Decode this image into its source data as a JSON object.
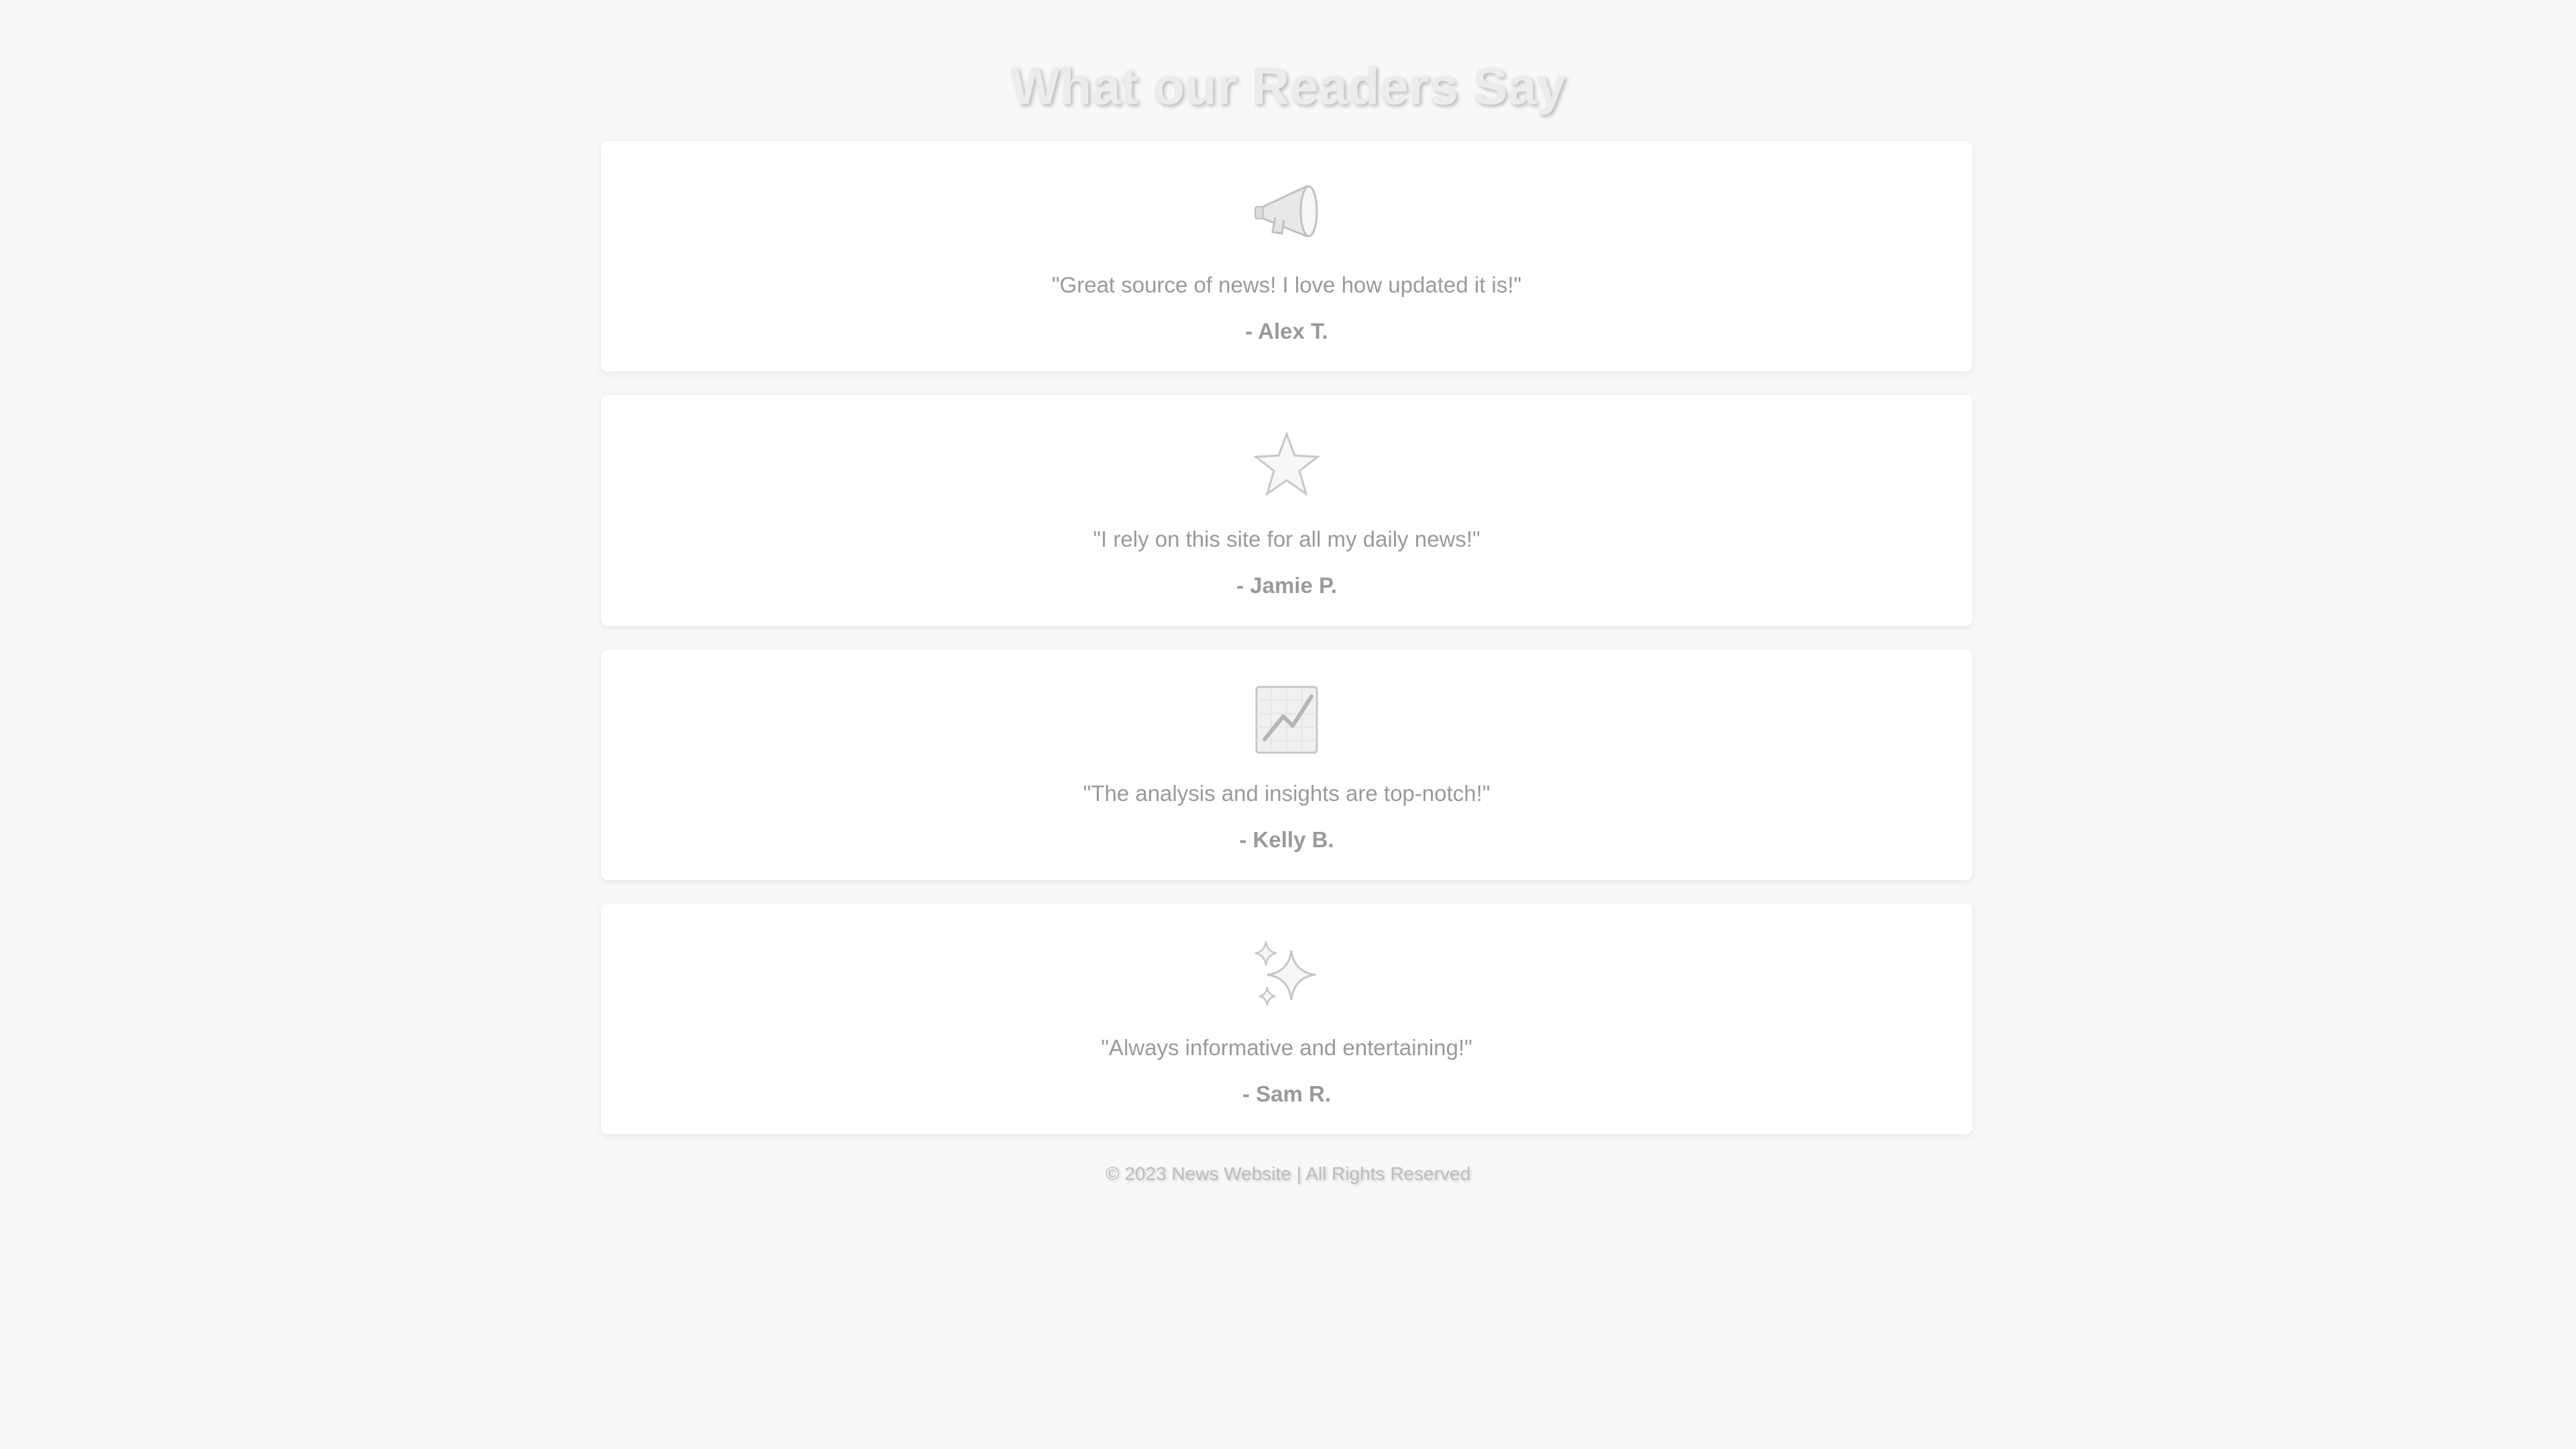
{
  "page": {
    "title": "What our Readers Say"
  },
  "testimonials": [
    {
      "icon": "megaphone-icon",
      "quote": "\"Great source of news! I love how updated it is!\"",
      "author": "- Alex T."
    },
    {
      "icon": "star-icon",
      "quote": "\"I rely on this site for all my daily news!\"",
      "author": "- Jamie P."
    },
    {
      "icon": "chart-increasing-icon",
      "quote": "\"The analysis and insights are top-notch!\"",
      "author": "- Kelly B."
    },
    {
      "icon": "sparkles-icon",
      "quote": "\"Always informative and entertaining!\"",
      "author": "- Sam R."
    }
  ],
  "footer": {
    "text": "© 2023 News Website | All Rights Reserved"
  },
  "colors": {
    "background": "#f8f8f8",
    "card": "#ffffff",
    "text": "#9a9a9a",
    "title": "#ececec"
  }
}
